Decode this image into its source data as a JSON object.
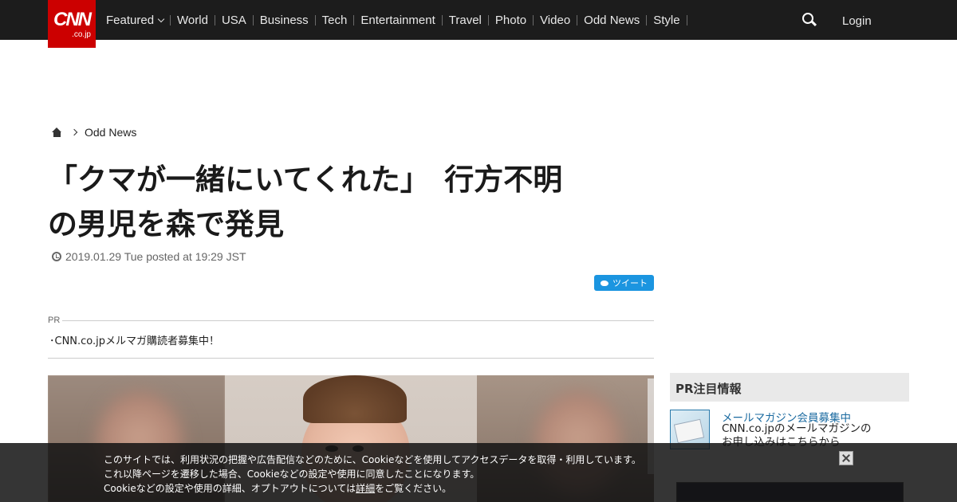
{
  "header": {
    "logo_main": "CNN",
    "logo_sub": ".co.jp",
    "nav": [
      {
        "label": "Featured",
        "dropdown": true
      },
      {
        "label": "World"
      },
      {
        "label": "USA"
      },
      {
        "label": "Business"
      },
      {
        "label": "Tech"
      },
      {
        "label": "Entertainment"
      },
      {
        "label": "Travel"
      },
      {
        "label": "Photo"
      },
      {
        "label": "Video"
      },
      {
        "label": "Odd News"
      },
      {
        "label": "Style"
      }
    ],
    "search_icon": "search-icon",
    "login": "Login"
  },
  "breadcrumb": {
    "home_icon": "home-icon",
    "section": "Odd News"
  },
  "article": {
    "title_line1": "「クマが一緒にいてくれた」　行方不明",
    "title_line2": "の男児を森で発見",
    "meta": "2019.01.29 Tue posted at 19:29 JST",
    "tweet": "ツイート"
  },
  "pr": {
    "label": "PR",
    "link": "･CNN.co.jpメルマガ購読者募集中！"
  },
  "sidebar": {
    "title": "PR注目情報",
    "link": "メールマガジン会員募集中",
    "desc_line1": "CNN.co.jpのメールマガジンの",
    "desc_line2": "お申し込みはこちらから"
  },
  "cookie": {
    "line1": "このサイトでは、利用状況の把握や広告配信などのために、Cookieなどを使用してアクセスデータを取得・利用しています。",
    "line2": "これ以降ページを遷移した場合、Cookieなどの設定や使用に同意したことになります。",
    "line3_prefix": "Cookieなどの設定や使用の詳細、オプトアウトについては",
    "line3_link": "詳細",
    "line3_suffix": "をご覧ください。"
  },
  "colors": {
    "header_bg": "#1c1c1c",
    "logo_red": "#cc0000",
    "tweet_blue": "#1b95e0",
    "link_blue": "#1a6aa0"
  }
}
